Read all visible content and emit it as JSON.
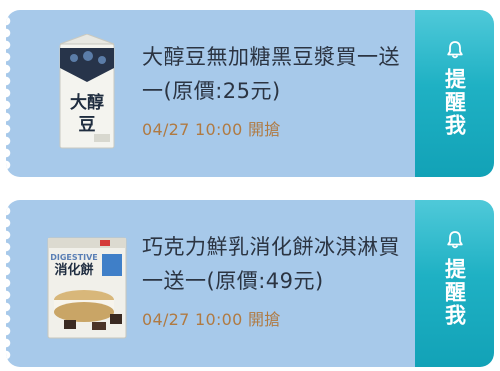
{
  "coupons": [
    {
      "title": "大醇豆無加糖黑豆漿買一送一(原價:25元)",
      "time": "04/27 10:00 開搶",
      "remind_label": "提醒我",
      "product_brand_text": "大醇豆",
      "icon": "bell-icon"
    },
    {
      "title": "巧克力鮮乳消化餅冰淇淋買一送一(原價:49元)",
      "time": "04/27 10:00 開搶",
      "remind_label": "提醒我",
      "product_brand_text": "DIGESTIVE 消化餅",
      "icon": "bell-icon"
    }
  ],
  "colors": {
    "ticket": "#a7c9ea",
    "remind_tab": "#1fb1c4",
    "time_text": "#b07a42"
  }
}
